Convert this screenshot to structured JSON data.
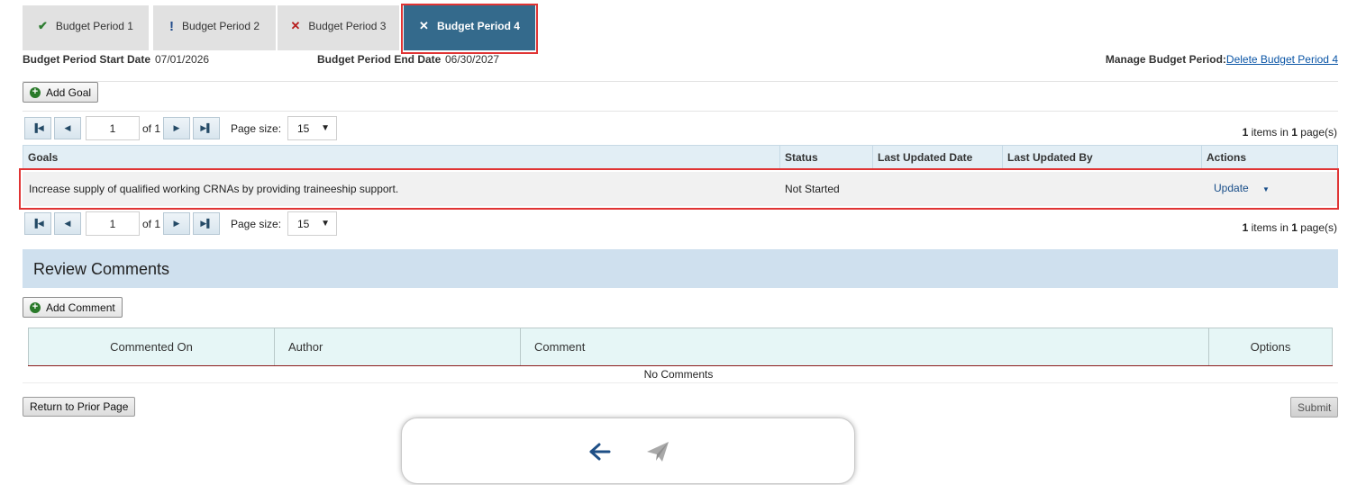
{
  "tabs": [
    {
      "label": "Budget Period 1",
      "icon": "check-icon",
      "glyph": "✔",
      "color": "#2e7d32"
    },
    {
      "label": "Budget Period 2",
      "icon": "exclamation-icon",
      "glyph": "!",
      "color": "#1f4a8a"
    },
    {
      "label": "Budget Period 3",
      "icon": "x-icon",
      "glyph": "✕",
      "color": "#b71c1c"
    },
    {
      "label": "Budget Period 4",
      "icon": "x-icon",
      "glyph": "✕",
      "color": "#ffffff",
      "active": true
    }
  ],
  "period": {
    "start_label": "Budget Period Start Date",
    "start_value": "07/01/2026",
    "end_label": "Budget Period End Date",
    "end_value": "06/30/2027",
    "manage_label": "Manage Budget Period:",
    "delete_link": "Delete Budget Period 4"
  },
  "add_goal_label": "Add Goal",
  "pager": {
    "page_value": "1",
    "of_label": "of 1",
    "page_size_label": "Page size:",
    "page_size_value": "15",
    "items_count": "1",
    "items_mid": " items in ",
    "pages_count": "1",
    "items_end": " page(s)"
  },
  "goals_table": {
    "headers": [
      "Goals",
      "Status",
      "Last Updated Date",
      "Last Updated By",
      "Actions"
    ],
    "rows": [
      {
        "goal": "Increase supply of qualified working CRNAs by providing traineeship support.",
        "status": "Not Started",
        "last_updated_date": "",
        "last_updated_by": "",
        "action": "Update"
      }
    ]
  },
  "review_comments": {
    "title": "Review Comments",
    "add_label": "Add Comment",
    "headers": [
      "Commented On",
      "Author",
      "Comment",
      "Options"
    ],
    "empty_text": "No Comments"
  },
  "footer": {
    "return_label": "Return to Prior Page",
    "submit_label": "Submit"
  },
  "colors": {
    "active_tab": "#346a8c",
    "highlight_outline": "#e03434",
    "link": "#0a55a6",
    "header_bg": "#e2eef5",
    "section_bar": "#cfe0ee"
  }
}
